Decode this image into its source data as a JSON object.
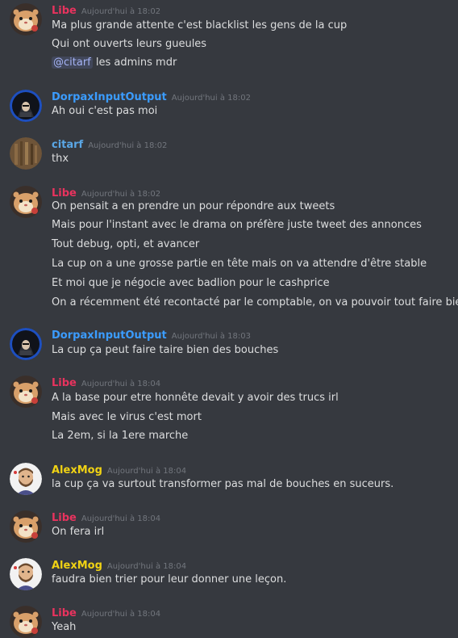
{
  "colors": {
    "background": "#36393f",
    "text": "#dcddde",
    "timestamp": "#72767d",
    "libe": "#e8335e",
    "dorpax": "#3b9cff",
    "citarf": "#5aa7e6",
    "alexmog": "#f0d214"
  },
  "messages": [
    {
      "author": "Libe",
      "timestamp": "Aujourd'hui à 18:02",
      "avatar_icon": "hamster-avatar-icon",
      "lines": [
        "Ma plus grande attente c'est blacklist les gens de la cup",
        "Qui ont ouverts leurs gueules",
        "les admins mdr"
      ],
      "mention": "@citarf"
    },
    {
      "author": "DorpaxInputOutput",
      "timestamp": "Aujourd'hui à 18:02",
      "avatar_icon": "hooded-figure-avatar-icon",
      "lines": [
        "Ah oui c'est pas moi"
      ]
    },
    {
      "author": "citarf",
      "timestamp": "Aujourd'hui à 18:02",
      "avatar_icon": "brown-texture-avatar-icon",
      "lines": [
        "thx"
      ]
    },
    {
      "author": "Libe",
      "timestamp": "Aujourd'hui à 18:02",
      "avatar_icon": "hamster-avatar-icon",
      "lines": [
        "On pensait a en prendre un pour répondre aux tweets",
        "Mais pour l'instant avec le drama on préfère juste tweet des annonces",
        "Tout debug, opti, et avancer",
        "La cup on a une grosse partie en tête mais on va attendre d'être stable",
        "Et moi que je négocie avec badlion pour le cashprice",
        "On a récemment été recontacté par le comptable, on va pouvoir tout faire bien"
      ]
    },
    {
      "author": "DorpaxInputOutput",
      "timestamp": "Aujourd'hui à 18:03",
      "avatar_icon": "hooded-figure-avatar-icon",
      "lines": [
        "La cup ça peut faire taire bien des bouches"
      ]
    },
    {
      "author": "Libe",
      "timestamp": "Aujourd'hui à 18:04",
      "avatar_icon": "hamster-avatar-icon",
      "lines": [
        "A la base pour etre honnête devait y avoir des trucs irl",
        "Mais avec le virus c'est mort",
        "La 2em, si la 1ere marche"
      ]
    },
    {
      "author": "AlexMog",
      "timestamp": "Aujourd'hui à 18:04",
      "avatar_icon": "bearded-man-avatar-icon",
      "lines": [
        "la cup ça va surtout transformer pas mal de bouches en suceurs."
      ]
    },
    {
      "author": "Libe",
      "timestamp": "Aujourd'hui à 18:04",
      "avatar_icon": "hamster-avatar-icon",
      "lines": [
        "On fera irl"
      ]
    },
    {
      "author": "AlexMog",
      "timestamp": "Aujourd'hui à 18:04",
      "avatar_icon": "bearded-man-avatar-icon",
      "lines": [
        "faudra bien trier pour leur donner une leçon."
      ]
    },
    {
      "author": "Libe",
      "timestamp": "Aujourd'hui à 18:04",
      "avatar_icon": "hamster-avatar-icon",
      "lines": [
        "Yeah"
      ]
    }
  ]
}
